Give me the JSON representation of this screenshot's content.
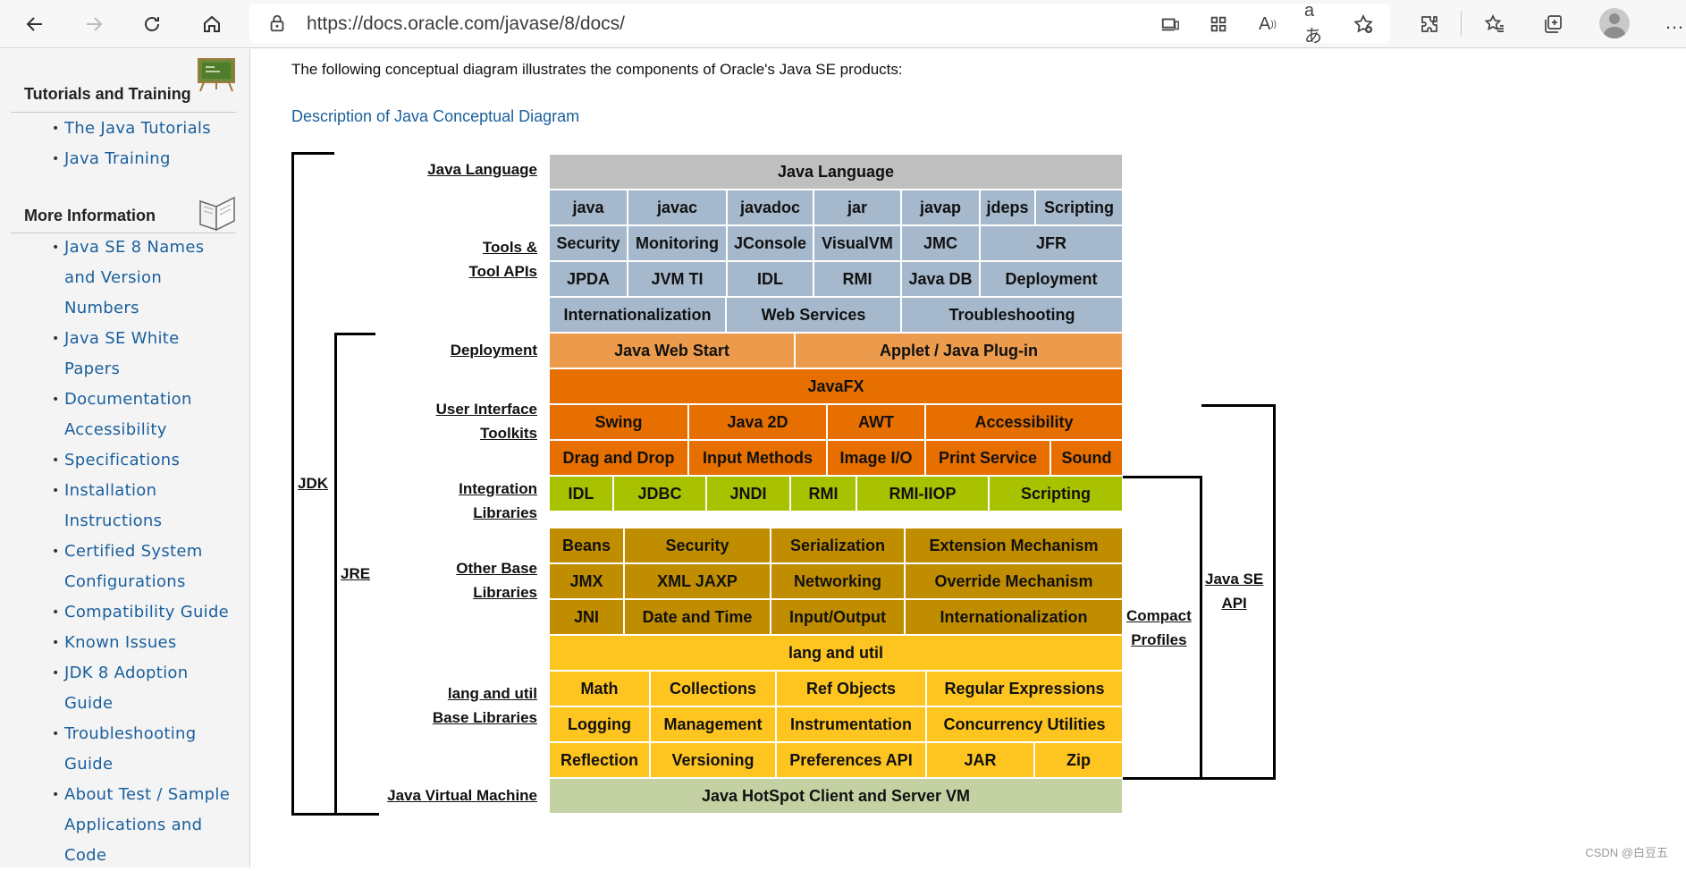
{
  "browser": {
    "url": "https://docs.oracle.com/javase/8/docs/"
  },
  "sidebar": {
    "tutorials_heading": "Tutorials and Training",
    "tutorials_links": [
      "The Java Tutorials",
      "Java Training"
    ],
    "more_heading": "More Information",
    "more_links": [
      [
        "Java SE 8 Names",
        "and Version",
        "Numbers"
      ],
      [
        "Java SE White",
        "Papers"
      ],
      [
        "Documentation",
        "Accessibility"
      ],
      [
        "Specifications"
      ],
      [
        "Installation",
        "Instructions"
      ],
      [
        "Certified System",
        "Configurations"
      ],
      [
        "Compatibility Guide"
      ],
      [
        "Known Issues"
      ],
      [
        "JDK 8 Adoption",
        "Guide"
      ],
      [
        "Troubleshooting",
        "Guide"
      ],
      [
        "About Test / Sample",
        "Applications and",
        "Code"
      ]
    ]
  },
  "content": {
    "intro": "The following conceptual diagram illustrates the components of Oracle's Java SE products:",
    "description_link": "Description of Java Conceptual Diagram"
  },
  "diagram": {
    "colors": {
      "language": "#bfbfbf",
      "tools": "#a5b8cc",
      "deployment": "#ec9b4c",
      "ui": "#e66f00",
      "integration": "#a8c200",
      "other": "#c18d00",
      "lang": "#fec420",
      "jvm": "#c4d2a3"
    },
    "rows": [
      {
        "group": "language",
        "cells": [
          "Java Language"
        ]
      },
      {
        "group": "tools",
        "cells": [
          "java",
          "javac",
          "javadoc",
          "jar",
          "javap",
          "jdeps",
          "Scripting"
        ]
      },
      {
        "group": "tools",
        "cells": [
          "Security",
          "Monitoring",
          "JConsole",
          "VisualVM",
          "JMC",
          "JFR"
        ]
      },
      {
        "group": "tools",
        "cells": [
          "JPDA",
          "JVM TI",
          "IDL",
          "RMI",
          "Java DB",
          "Deployment"
        ]
      },
      {
        "group": "tools",
        "cells": [
          "Internationalization",
          "Web Services",
          "Troubleshooting"
        ]
      },
      {
        "group": "deployment",
        "cells": [
          "Java Web Start",
          "Applet / Java Plug-in"
        ]
      },
      {
        "group": "ui",
        "cells": [
          "JavaFX"
        ]
      },
      {
        "group": "ui",
        "cells": [
          "Swing",
          "Java 2D",
          "AWT",
          "Accessibility"
        ]
      },
      {
        "group": "ui",
        "cells": [
          "Drag and Drop",
          "Input Methods",
          "Image I/O",
          "Print Service",
          "Sound"
        ]
      },
      {
        "group": "integration",
        "cells": [
          "IDL",
          "JDBC",
          "JNDI",
          "RMI",
          "RMI-IIOP",
          "Scripting"
        ]
      },
      {
        "group": "other",
        "cells": [
          "Beans",
          "Security",
          "Serialization",
          "Extension Mechanism"
        ]
      },
      {
        "group": "other",
        "cells": [
          "JMX",
          "XML JAXP",
          "Networking",
          "Override Mechanism"
        ]
      },
      {
        "group": "other",
        "cells": [
          "JNI",
          "Date and Time",
          "Input/Output",
          "Internationalization"
        ]
      },
      {
        "group": "lang",
        "cells": [
          "lang and util"
        ]
      },
      {
        "group": "lang",
        "cells": [
          "Math",
          "Collections",
          "Ref Objects",
          "Regular Expressions"
        ]
      },
      {
        "group": "lang",
        "cells": [
          "Logging",
          "Management",
          "Instrumentation",
          "Concurrency Utilities"
        ]
      },
      {
        "group": "lang",
        "cells": [
          "Reflection",
          "Versioning",
          "Preferences API",
          "JAR",
          "Zip"
        ]
      },
      {
        "group": "jvm",
        "cells": [
          "Java HotSpot Client and Server VM"
        ]
      }
    ],
    "row_labels": {
      "language": [
        "Java Language"
      ],
      "tools": [
        "Tools &",
        "Tool APIs"
      ],
      "deployment": [
        "Deployment"
      ],
      "ui": [
        "User Interface",
        "Toolkits"
      ],
      "integration": [
        "Integration",
        "Libraries"
      ],
      "other": [
        "Other Base",
        "Libraries"
      ],
      "lang": [
        "lang and util",
        "Base Libraries"
      ],
      "jvm": [
        "Java Virtual Machine"
      ]
    },
    "bracket_labels": {
      "jdk": "JDK",
      "jre": "JRE",
      "compact": [
        "Compact",
        "Profiles"
      ],
      "api": [
        "Java SE",
        "API"
      ]
    }
  },
  "watermark": "CSDN @白豆五"
}
